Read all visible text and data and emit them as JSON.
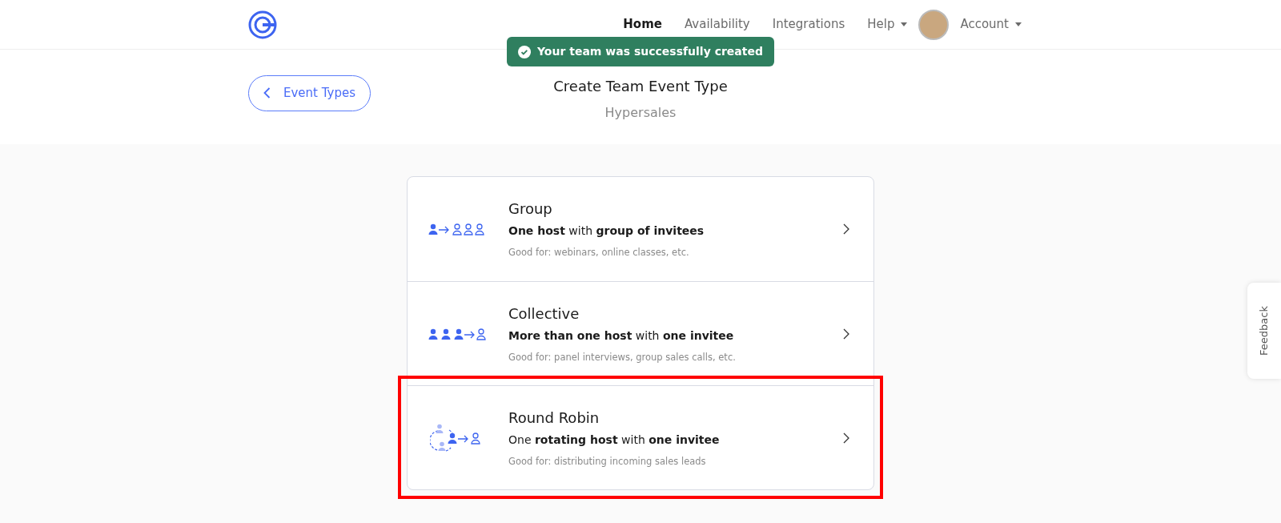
{
  "nav": {
    "items": [
      {
        "label": "Home",
        "selected": true,
        "dropdown": false
      },
      {
        "label": "Availability",
        "selected": false,
        "dropdown": false
      },
      {
        "label": "Integrations",
        "selected": false,
        "dropdown": false
      },
      {
        "label": "Help",
        "selected": false,
        "dropdown": true
      }
    ],
    "account": {
      "label": "Account"
    }
  },
  "toast": {
    "message": "Your team was successfully created"
  },
  "back_button": {
    "label": "Event Types"
  },
  "header": {
    "title": "Create Team Event Type",
    "subtitle": "Hypersales"
  },
  "event_types": [
    {
      "kind": "group",
      "title": "Group",
      "description": "**One host** with **group of invitees**",
      "good_for": "Good for: webinars, online classes, etc.",
      "highlighted": false
    },
    {
      "kind": "collective",
      "title": "Collective",
      "description": "**More than one host** with **one invitee**",
      "good_for": "Good for: panel interviews, group sales calls, etc.",
      "highlighted": false
    },
    {
      "kind": "round_robin",
      "title": "Round Robin",
      "description": "One **rotating host** with **one invitee**",
      "good_for": "Good for: distributing incoming sales leads",
      "highlighted": true
    }
  ],
  "feedback": {
    "label": "Feedback"
  }
}
